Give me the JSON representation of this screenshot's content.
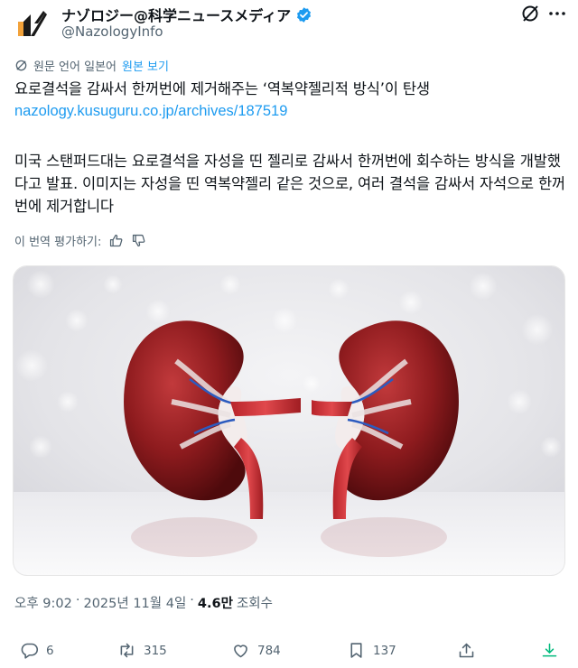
{
  "author": {
    "display_name": "ナゾロジー@科学ニュースメディア",
    "handle": "@NazologyInfo"
  },
  "translation": {
    "notice": "원문 언어 일본어",
    "show_original": "원본 보기",
    "rate_prompt": "이 번역 평가하기:"
  },
  "tweet": {
    "line1": "요로결석을 감싸서 한꺼번에 제거해주는 ‘역복약젤리적 방식’이 탄생",
    "link": "nazology.kusuguru.co.jp/archives/187519",
    "body": "미국 스탠퍼드대는 요로결석을 자성을 띤 젤리로 감싸서 한꺼번에 회수하는 방식을 개발했다고 발표. 이미지는 자성을 띤 역복약젤리 같은 것으로, 여러 결석을 감싸서 자석으로 한꺼번에 제거합니다"
  },
  "meta": {
    "time": "오후 9:02",
    "sep": "·",
    "date": "2025년 11월 4일",
    "views_num": "4.6만",
    "views_label": "조회수"
  },
  "actions": {
    "replies": "6",
    "reposts": "315",
    "likes": "784",
    "bookmarks": "137"
  },
  "colors": {
    "accent": "#1d9bf0",
    "secondary_text": "#536471",
    "kidney": "#8e1b1e"
  },
  "icons": [
    "verified-badge-icon",
    "grok-icon",
    "more-icon",
    "translate-icon",
    "thumbs-up-icon",
    "thumbs-down-icon",
    "reply-icon",
    "repost-icon",
    "like-icon",
    "bookmark-icon",
    "share-icon",
    "download-icon"
  ]
}
